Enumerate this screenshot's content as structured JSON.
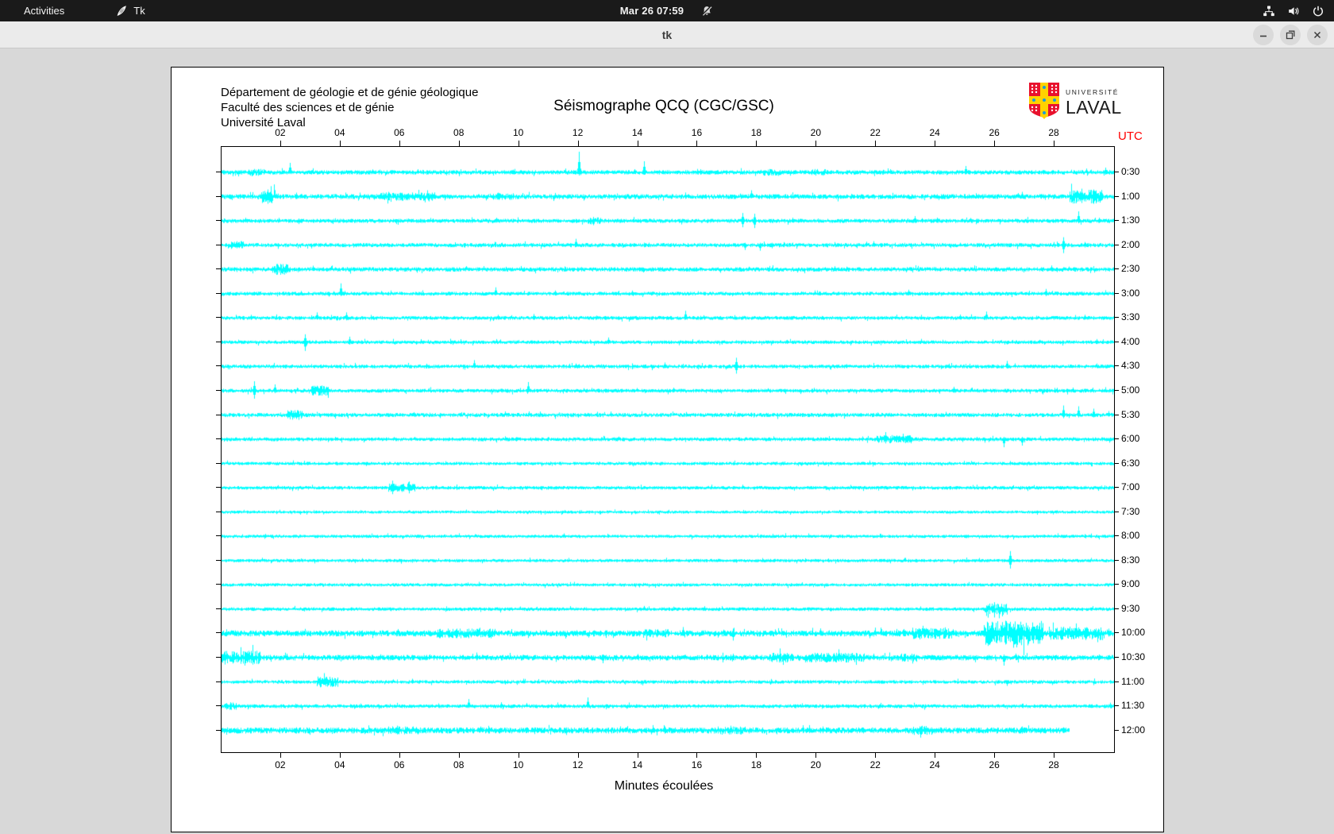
{
  "topbar": {
    "activities": "Activities",
    "app_name": "Tk",
    "clock": "Mar 26 07:59",
    "icons": [
      "tk-icon",
      "notifications-disabled-icon",
      "network-icon",
      "volume-icon",
      "power-icon"
    ],
    "bg_color": "#1a1a1a"
  },
  "titlebar": {
    "title": "tk",
    "buttons": [
      "minimize",
      "maximize",
      "close"
    ]
  },
  "figure": {
    "header_lines": [
      "Département de géologie et de génie géologique",
      "Faculté des sciences et de génie",
      "Université Laval"
    ],
    "title": "Séismographe QCQ (CGC/GSC)",
    "utc_label": "UTC",
    "xlabel": "Minutes écoulées",
    "logo": {
      "line1": "UNIVERSITÉ",
      "line2": "LAVAL",
      "shield_red": "#e8112d",
      "shield_gold": "#ffd200",
      "shield_blue": "#1b9dd9"
    }
  },
  "chart_data": {
    "type": "line",
    "subtype": "seismogram-helicorder",
    "title": "Séismographe QCQ (CGC/GSC)",
    "xlabel": "Minutes écoulées",
    "x_range": [
      0,
      30
    ],
    "x_ticks": [
      "02",
      "04",
      "06",
      "08",
      "10",
      "12",
      "14",
      "16",
      "18",
      "20",
      "22",
      "24",
      "26",
      "28"
    ],
    "right_axis_label": "UTC",
    "trace_color": "#00ffff",
    "grid": false,
    "rows": [
      {
        "label": "0:30",
        "base": 1.6,
        "bands": [
          [
            0.9,
            1.4,
            2.5
          ],
          [
            18.2,
            18.8,
            2.5
          ],
          [
            19.8,
            20.3,
            2.5
          ]
        ],
        "spikes": [
          [
            2.3,
            12,
            2
          ],
          [
            6.6,
            4,
            2
          ],
          [
            12.0,
            26,
            4
          ],
          [
            14.2,
            14,
            3
          ],
          [
            16.1,
            4,
            3
          ],
          [
            25.0,
            8,
            2
          ],
          [
            29.7,
            6,
            3
          ]
        ]
      },
      {
        "label": "1:00",
        "base": 1.8,
        "bands": [
          [
            1.3,
            1.9,
            5
          ],
          [
            5.3,
            7.2,
            3
          ],
          [
            9.0,
            9.8,
            2.5
          ],
          [
            28.5,
            29.6,
            5
          ]
        ],
        "spikes": [
          [
            1.55,
            9,
            9
          ],
          [
            2.5,
            5,
            3
          ],
          [
            5.6,
            6,
            4
          ],
          [
            6.0,
            5,
            3
          ],
          [
            6.9,
            8,
            3
          ],
          [
            9.3,
            5,
            3
          ],
          [
            11.2,
            4,
            2
          ],
          [
            14.1,
            3,
            2
          ],
          [
            17.8,
            8,
            2
          ],
          [
            26.9,
            6,
            2
          ],
          [
            28.9,
            10,
            8
          ],
          [
            29.3,
            9,
            9
          ]
        ]
      },
      {
        "label": "1:30",
        "base": 1.5,
        "bands": [
          [
            12.3,
            12.8,
            2.5
          ]
        ],
        "spikes": [
          [
            0.8,
            4,
            2
          ],
          [
            2.6,
            3,
            4
          ],
          [
            7.1,
            3,
            2
          ],
          [
            12.5,
            5,
            2
          ],
          [
            17.5,
            10,
            8
          ],
          [
            17.9,
            9,
            9
          ],
          [
            19.2,
            4,
            2
          ],
          [
            23.3,
            6,
            2
          ],
          [
            28.8,
            12,
            3
          ],
          [
            29.5,
            4,
            2
          ]
        ]
      },
      {
        "label": "2:00",
        "base": 1.5,
        "bands": [
          [
            0.3,
            0.8,
            3
          ]
        ],
        "spikes": [
          [
            0.5,
            5,
            4
          ],
          [
            11.9,
            8,
            2
          ],
          [
            17.6,
            3,
            6
          ],
          [
            18.1,
            3,
            7
          ],
          [
            18.5,
            3,
            4
          ],
          [
            21.9,
            5,
            2
          ],
          [
            26.1,
            3,
            2
          ],
          [
            28.3,
            10,
            10
          ],
          [
            29.0,
            4,
            3
          ]
        ]
      },
      {
        "label": "2:30",
        "base": 1.6,
        "bands": [
          [
            1.7,
            2.3,
            4
          ]
        ],
        "spikes": [
          [
            2.2,
            6,
            3
          ],
          [
            12.1,
            3,
            2
          ],
          [
            20.6,
            4,
            2
          ],
          [
            24.0,
            3,
            2
          ],
          [
            27.9,
            5,
            2
          ]
        ]
      },
      {
        "label": "3:00",
        "base": 1.4,
        "bands": [],
        "spikes": [
          [
            4.0,
            13,
            3
          ],
          [
            9.2,
            8,
            2
          ],
          [
            13.8,
            4,
            2
          ],
          [
            20.1,
            3,
            2
          ],
          [
            23.1,
            5,
            2
          ],
          [
            27.7,
            6,
            3
          ],
          [
            28.9,
            3,
            2
          ]
        ]
      },
      {
        "label": "3:30",
        "base": 1.4,
        "bands": [],
        "spikes": [
          [
            1.0,
            4,
            2
          ],
          [
            3.2,
            7,
            2
          ],
          [
            4.2,
            7,
            3
          ],
          [
            9.3,
            4,
            2
          ],
          [
            10.5,
            5,
            2
          ],
          [
            12.6,
            3,
            2
          ],
          [
            15.6,
            9,
            2
          ],
          [
            25.7,
            8,
            2
          ],
          [
            29.0,
            4,
            2
          ]
        ]
      },
      {
        "label": "4:00",
        "base": 1.3,
        "bands": [],
        "spikes": [
          [
            2.8,
            10,
            11
          ],
          [
            4.3,
            7,
            3
          ],
          [
            13.0,
            6,
            2
          ],
          [
            19.0,
            3,
            2
          ],
          [
            29.4,
            4,
            2
          ]
        ]
      },
      {
        "label": "4:30",
        "base": 1.4,
        "bands": [],
        "spikes": [
          [
            8.5,
            8,
            2
          ],
          [
            12.0,
            3,
            2
          ],
          [
            14.9,
            5,
            2
          ],
          [
            17.3,
            11,
            9
          ],
          [
            21.0,
            3,
            2
          ],
          [
            26.4,
            7,
            2
          ]
        ]
      },
      {
        "label": "5:00",
        "base": 1.4,
        "bands": [
          [
            3.0,
            3.6,
            4
          ]
        ],
        "spikes": [
          [
            1.1,
            12,
            10
          ],
          [
            1.8,
            8,
            3
          ],
          [
            3.3,
            6,
            5
          ],
          [
            10.3,
            11,
            2
          ],
          [
            24.6,
            5,
            2
          ],
          [
            28.6,
            4,
            2
          ]
        ]
      },
      {
        "label": "5:30",
        "base": 1.5,
        "bands": [
          [
            2.2,
            2.7,
            3.5
          ]
        ],
        "spikes": [
          [
            2.4,
            5,
            3
          ],
          [
            17.8,
            3,
            2
          ],
          [
            28.3,
            12,
            4
          ],
          [
            28.8,
            11,
            3
          ],
          [
            29.3,
            8,
            3
          ],
          [
            29.8,
            5,
            2
          ]
        ]
      },
      {
        "label": "6:00",
        "base": 1.4,
        "bands": [
          [
            22.0,
            23.2,
            3
          ]
        ],
        "spikes": [
          [
            22.3,
            9,
            3
          ],
          [
            22.9,
            7,
            3
          ],
          [
            26.3,
            3,
            10
          ],
          [
            26.9,
            3,
            8
          ]
        ]
      },
      {
        "label": "6:30",
        "base": 1.2,
        "bands": [],
        "spikes": [
          [
            14.0,
            2,
            1.5
          ],
          [
            20.3,
            2,
            1.5
          ]
        ]
      },
      {
        "label": "7:00",
        "base": 1.3,
        "bands": [
          [
            5.6,
            6.5,
            3
          ]
        ],
        "spikes": [
          [
            5.75,
            9,
            8
          ],
          [
            6.3,
            8,
            7
          ]
        ]
      },
      {
        "label": "7:30",
        "base": 1.1,
        "bands": [],
        "spikes": []
      },
      {
        "label": "8:00",
        "base": 1.2,
        "bands": [],
        "spikes": [
          [
            12.0,
            2,
            1.5
          ]
        ]
      },
      {
        "label": "8:30",
        "base": 1.2,
        "bands": [],
        "spikes": [
          [
            26.5,
            12,
            10
          ]
        ]
      },
      {
        "label": "9:00",
        "base": 1.2,
        "bands": [],
        "spikes": [
          [
            12.5,
            2,
            1.5
          ]
        ]
      },
      {
        "label": "9:30",
        "base": 1.3,
        "bands": [
          [
            25.6,
            26.4,
            4
          ]
        ],
        "spikes": [
          [
            25.9,
            7,
            4
          ],
          [
            26.1,
            6,
            3
          ]
        ]
      },
      {
        "label": "10:00",
        "base": 2.2,
        "bands": [
          [
            7.2,
            9.2,
            3.5
          ],
          [
            14.2,
            15.0,
            3
          ],
          [
            23.2,
            24.6,
            4
          ],
          [
            25.6,
            27.6,
            9
          ],
          [
            27.8,
            29.6,
            5
          ]
        ],
        "spikes": [
          [
            7.6,
            6,
            4
          ],
          [
            15.5,
            8,
            3
          ],
          [
            17.2,
            6,
            9
          ],
          [
            24.0,
            6,
            5
          ],
          [
            26.35,
            16,
            14
          ],
          [
            26.6,
            12,
            18
          ],
          [
            27.1,
            10,
            12
          ],
          [
            28.2,
            8,
            8
          ],
          [
            29.0,
            7,
            6
          ],
          [
            29.8,
            6,
            4
          ]
        ]
      },
      {
        "label": "10:30",
        "base": 2.0,
        "bands": [
          [
            0.0,
            1.3,
            5
          ],
          [
            18.4,
            19.2,
            3.5
          ],
          [
            19.6,
            21.6,
            3.5
          ],
          [
            22.8,
            23.4,
            3
          ]
        ],
        "spikes": [
          [
            0.4,
            8,
            6
          ],
          [
            0.8,
            7,
            7
          ],
          [
            2.2,
            5,
            3
          ],
          [
            7.0,
            4,
            2
          ],
          [
            12.8,
            4,
            7
          ],
          [
            16.3,
            4,
            3
          ],
          [
            17.2,
            5,
            3
          ],
          [
            19.0,
            6,
            4
          ],
          [
            21.0,
            5,
            4
          ],
          [
            21.9,
            5,
            3
          ],
          [
            26.3,
            4,
            10
          ],
          [
            29.5,
            4,
            3
          ]
        ]
      },
      {
        "label": "11:00",
        "base": 1.3,
        "bands": [
          [
            3.2,
            3.9,
            4
          ]
        ],
        "spikes": [
          [
            3.5,
            6,
            4
          ],
          [
            6.4,
            4,
            2
          ],
          [
            14.5,
            2,
            2
          ],
          [
            26.4,
            2,
            5
          ]
        ]
      },
      {
        "label": "11:30",
        "base": 1.4,
        "bands": [
          [
            0.1,
            0.5,
            3
          ]
        ],
        "spikes": [
          [
            0.3,
            5,
            4
          ],
          [
            8.3,
            9,
            2
          ],
          [
            9.4,
            5,
            2
          ],
          [
            12.3,
            11,
            2
          ],
          [
            17.0,
            2,
            2
          ],
          [
            22.1,
            2,
            2
          ],
          [
            26.9,
            3,
            2
          ]
        ]
      },
      {
        "label": "12:00",
        "base": 2.2,
        "bands": [
          [
            5.6,
            6.6,
            3
          ],
          [
            16.6,
            17.6,
            3
          ],
          [
            23.2,
            23.9,
            3.5
          ]
        ],
        "spikes": [
          [
            2.5,
            4,
            3
          ],
          [
            5.9,
            6,
            4
          ],
          [
            14.9,
            5,
            4
          ],
          [
            17.1,
            6,
            4
          ],
          [
            20.2,
            5,
            3
          ],
          [
            23.5,
            4,
            9
          ],
          [
            26.9,
            5,
            4
          ],
          [
            28.3,
            4,
            3
          ]
        ],
        "end": 28.5
      }
    ]
  }
}
